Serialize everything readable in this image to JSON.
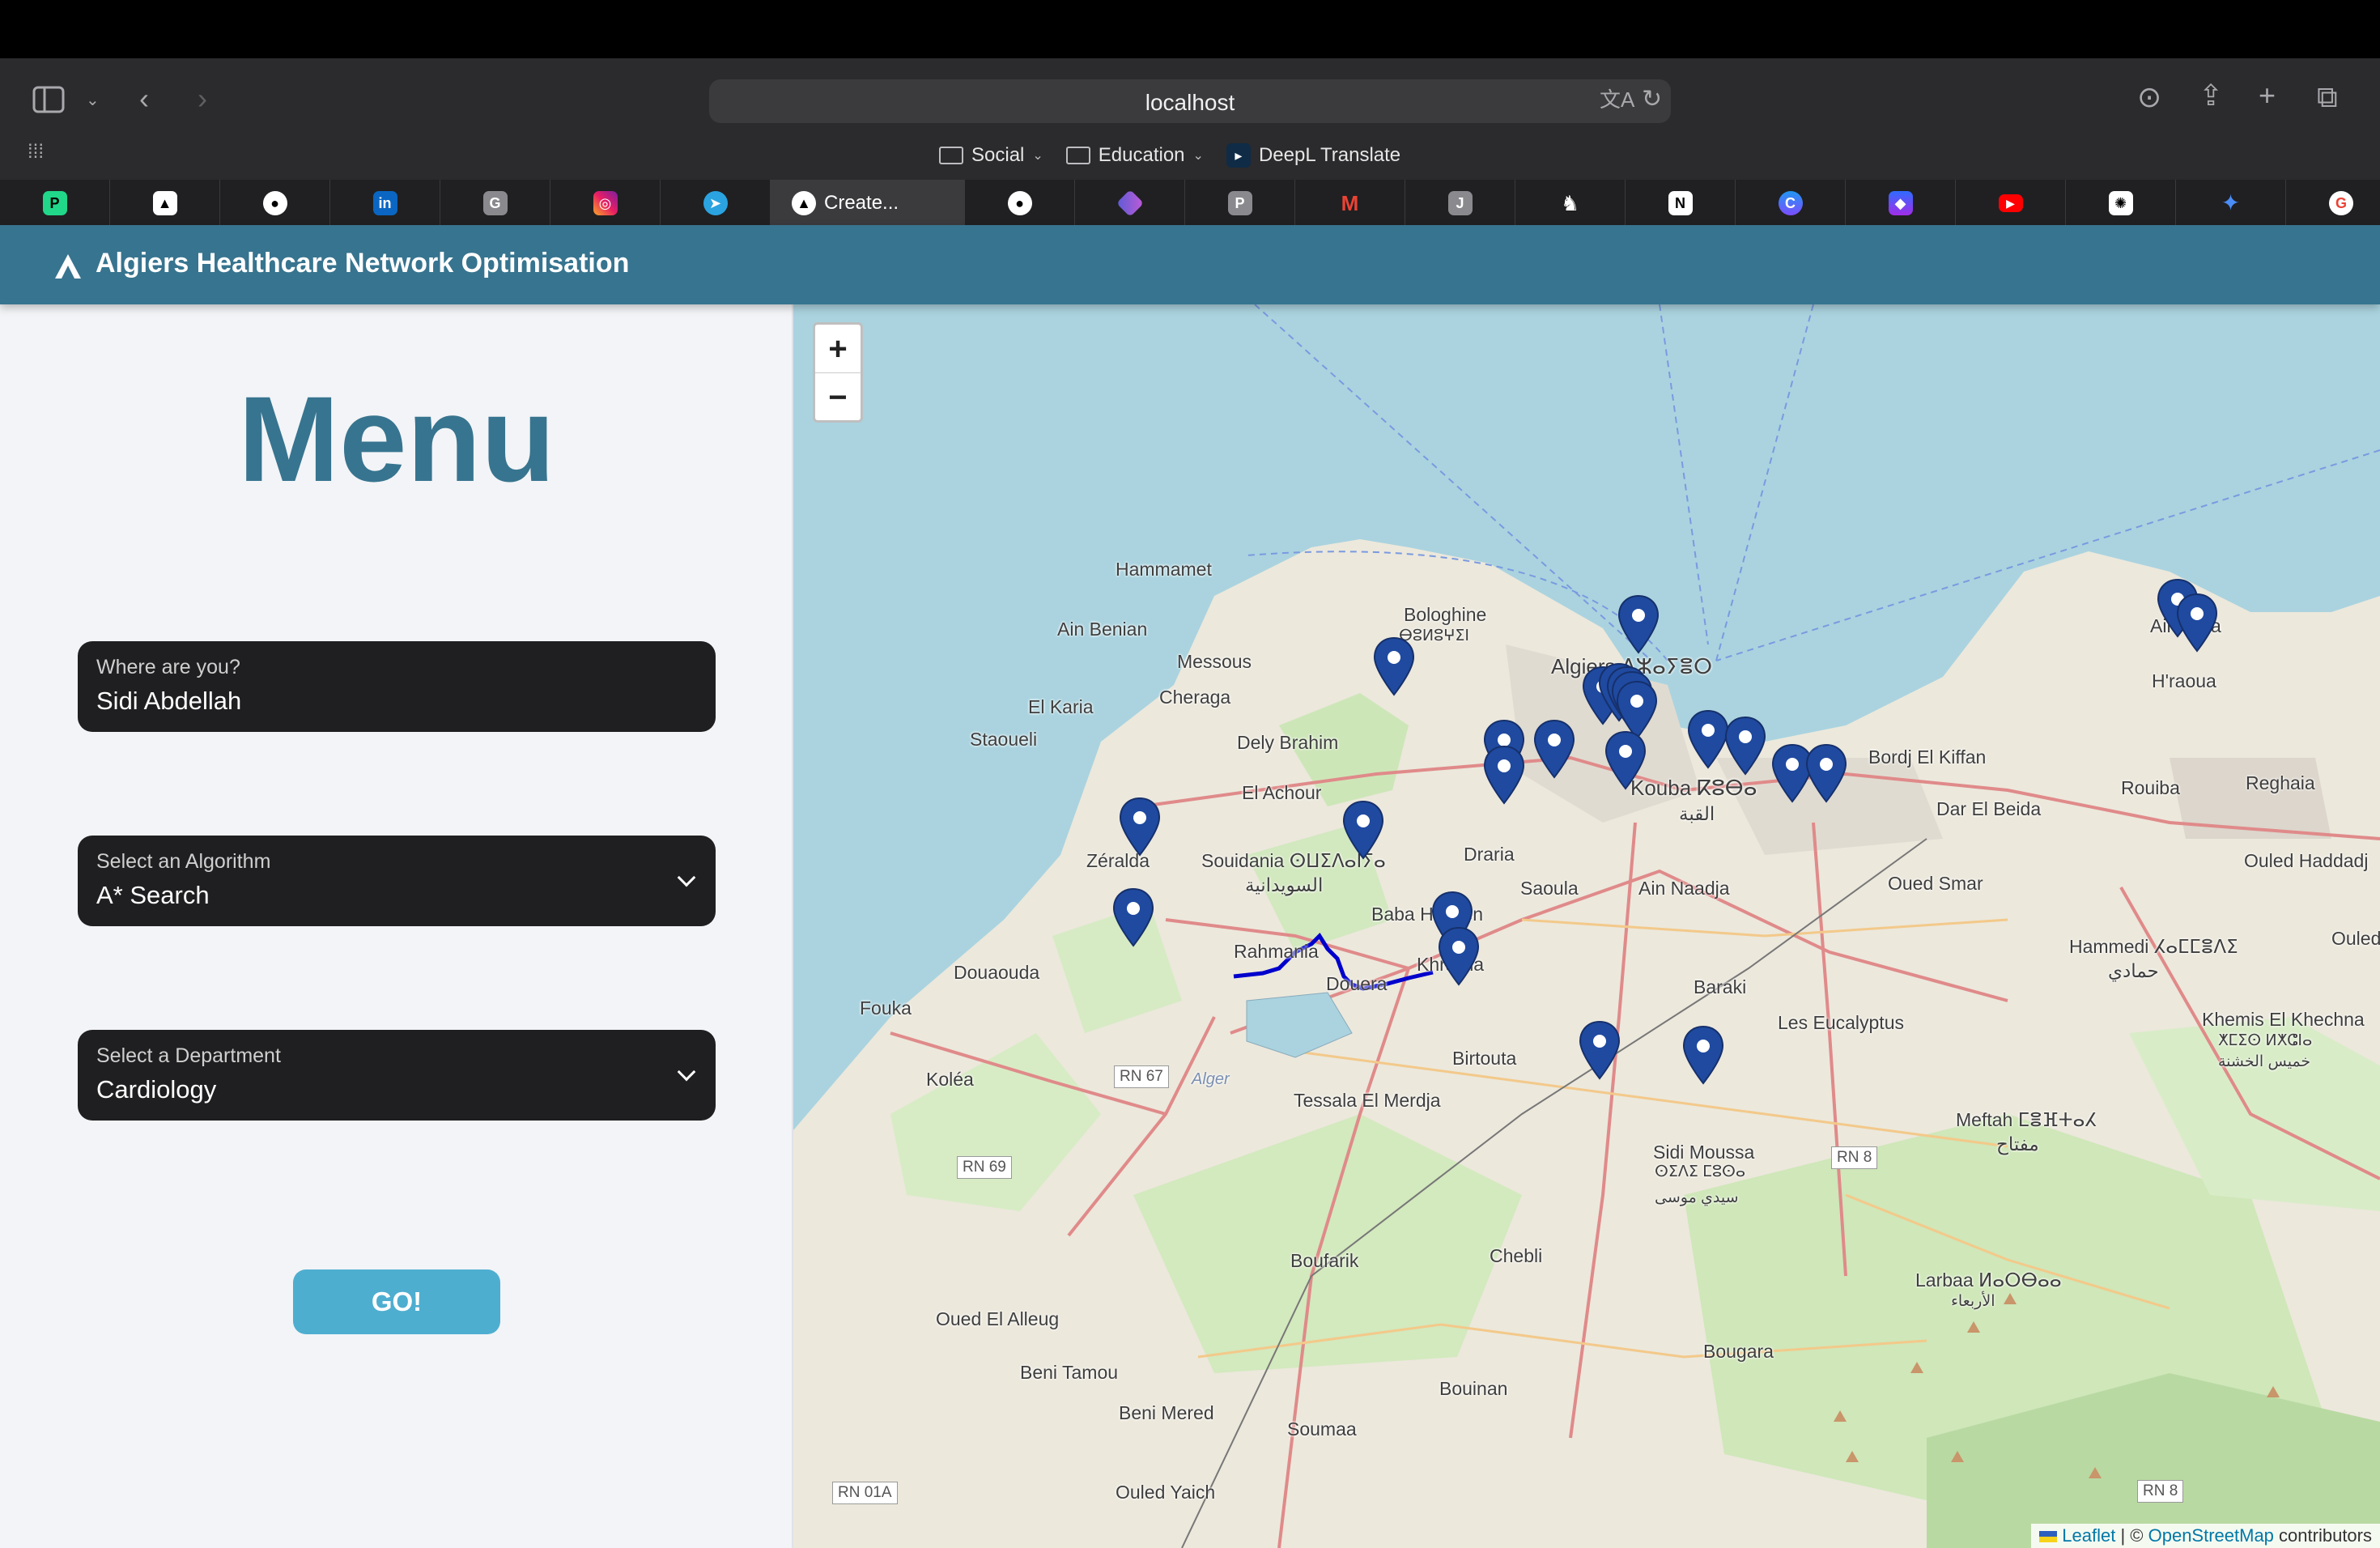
{
  "browser": {
    "url": "localhost",
    "bookmarks": [
      {
        "label": "Social",
        "type": "folder"
      },
      {
        "label": "Education",
        "type": "folder"
      },
      {
        "label": "DeepL Translate",
        "type": "link"
      }
    ],
    "active_tab_title": "Create..."
  },
  "app": {
    "title": "Algiers Healthcare Network Optimisation"
  },
  "sidebar": {
    "menu_title": "Menu",
    "location": {
      "label": "Where are you?",
      "value": "Sidi Abdellah"
    },
    "algorithm": {
      "label": "Select an Algorithm",
      "value": "A* Search"
    },
    "department": {
      "label": "Select a Department",
      "value": "Cardiology"
    },
    "go_label": "GO!"
  },
  "map": {
    "zoom_in": "+",
    "zoom_out": "−",
    "attribution": {
      "leaflet": "Leaflet",
      "separator": "| ©",
      "osm": "OpenStreetMap",
      "suffix": "contributors"
    },
    "marker_color": "#1f4aa0",
    "route_color": "#0000cc",
    "places": [
      "Hammamet",
      "Ain Benian",
      "Bologhine",
      "ⴱⵓⵍⵓⵖⵉⵏ",
      "Messous",
      "Cheraga",
      "El Karia",
      "Staoueli",
      "Dely Brahim",
      "El Achour",
      "Zéralda",
      "Souidania ⵙⵡⵉⴷⴰⵏⵢⴰ",
      "السويدانية",
      "Draria",
      "Saoula",
      "Baba Hassen",
      "Rahmania",
      "Douera",
      "Khraicia",
      "Douaouda",
      "Fouka",
      "Koléa",
      "Tessala El Merdja",
      "Birtouta",
      "Ain Naadja",
      "Baraki",
      "Kouba ⴽⵓⴱⴰ",
      "القبة",
      "Bordj El Kiffan",
      "Rouiba",
      "Reghaia",
      "Dar El Beida",
      "Oued Smar",
      "Ain Taya",
      "H'raoua",
      "Ouled Haddadj",
      "Hammedi ⵃⴰⵎⵎⴻⴷⵉ",
      "حمادي",
      "Ouled Mou",
      "Khemis El Khechna",
      "ⵅⵎⵉⵙ ⵍⵅⵛⵏⴰ",
      "خميس الخشنة",
      "Les Eucalyptus",
      "Meftah ⵎⴻⴼⵜⴰⵃ",
      "مفتاح",
      "Sidi Moussa",
      "ⵙⵉⴷⵉ ⵎⵓⵙⴰ",
      "سيدي موسى",
      "Chebli",
      "Boufarik",
      "Oued El Alleug",
      "Beni Tamou",
      "Beni Mered",
      "Soumaa",
      "Bouinan",
      "Bougara",
      "Larbaa ⵍⴰⵔⴱⴰⴰ",
      "الأربعاء",
      "Ouled Yaich",
      "Alger",
      "Algiers ⴷⵣⴰⵢⴻⵔ"
    ],
    "roads": [
      "RN 67",
      "RN 69",
      "RN 8",
      "RN 8",
      "RN 01A"
    ]
  }
}
